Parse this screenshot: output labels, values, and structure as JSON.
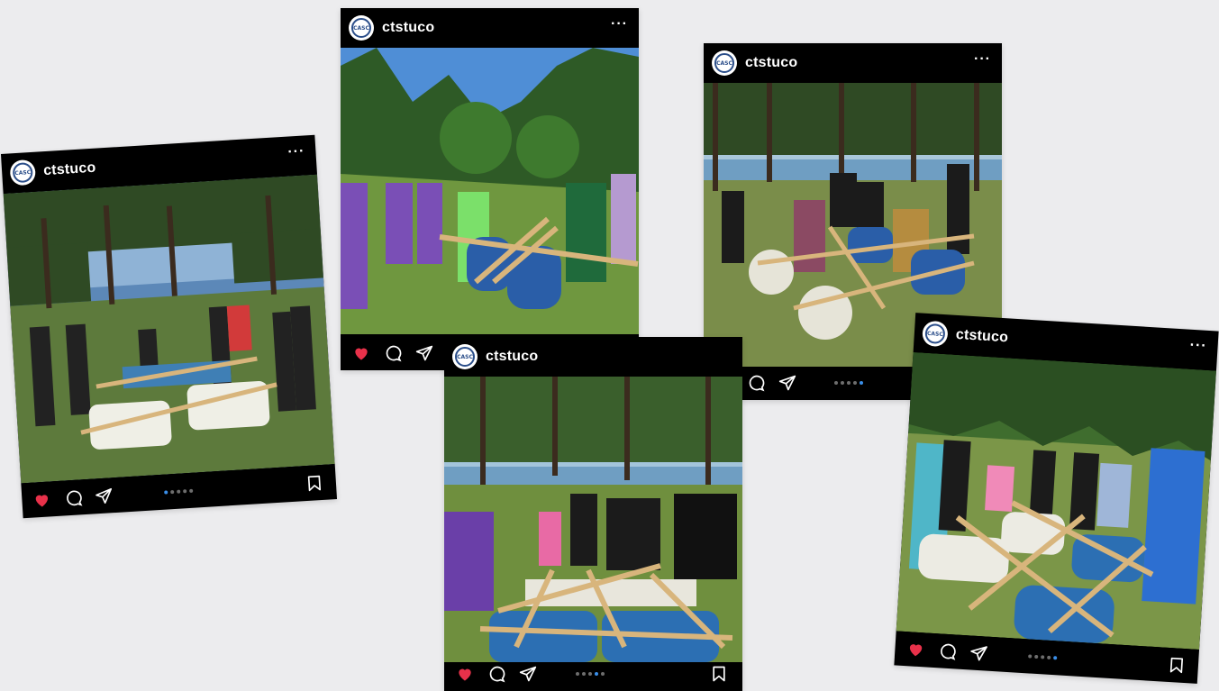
{
  "posts": [
    {
      "id": "p1",
      "username": "ctstuco",
      "avatar_text": "CASC",
      "active_dot": 0,
      "dot_count": 5,
      "bookmark": true
    },
    {
      "id": "p2",
      "username": "ctstuco",
      "avatar_text": "CASC",
      "active_dot": null,
      "dot_count": 0,
      "bookmark": false
    },
    {
      "id": "p3",
      "username": "ctstuco",
      "avatar_text": "CASC",
      "active_dot": 3,
      "dot_count": 5,
      "bookmark": true
    },
    {
      "id": "p4",
      "username": "ctstuco",
      "avatar_text": "CASC",
      "active_dot": 4,
      "dot_count": 5,
      "bookmark": false
    },
    {
      "id": "p5",
      "username": "ctstuco",
      "avatar_text": "CASC",
      "active_dot": 4,
      "dot_count": 5,
      "bookmark": true
    }
  ],
  "icons": {
    "like": "heart-icon",
    "comment": "comment-icon",
    "share": "share-icon",
    "more": "more-icon",
    "save": "bookmark-icon"
  },
  "colors": {
    "heart": "#e8314a",
    "dot_active": "#3a8ee8",
    "dot_inactive": "#6d6d6d",
    "background": "#ececee"
  }
}
